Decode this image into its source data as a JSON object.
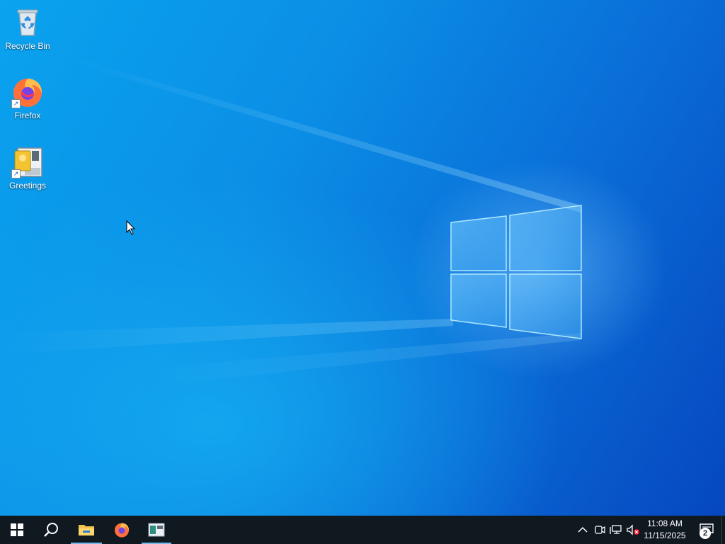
{
  "desktop": {
    "icons": [
      {
        "label": "Recycle Bin",
        "icon": "recycle-bin-icon"
      },
      {
        "label": "Firefox",
        "icon": "firefox-icon"
      },
      {
        "label": "Greetings",
        "icon": "greetings-app-icon"
      }
    ]
  },
  "taskbar": {
    "start_icon": "windows-logo-icon",
    "search_icon": "search-icon",
    "apps": [
      {
        "name": "File Explorer",
        "icon": "folder-icon",
        "active": true
      },
      {
        "name": "Firefox",
        "icon": "firefox-icon",
        "active": false
      },
      {
        "name": "Greetings",
        "icon": "greetings-app-icon",
        "active": true
      }
    ],
    "tray": {
      "icons": [
        "chevron-up-icon",
        "meet-now-icon",
        "network-icon",
        "volume-muted-icon"
      ],
      "time": "11:08 AM",
      "date": "11/15/2025",
      "notification_count": "2"
    }
  },
  "colors": {
    "taskbar": "#101820",
    "accent": "#76b9ed",
    "wallpaper": "#0a7fe0"
  }
}
